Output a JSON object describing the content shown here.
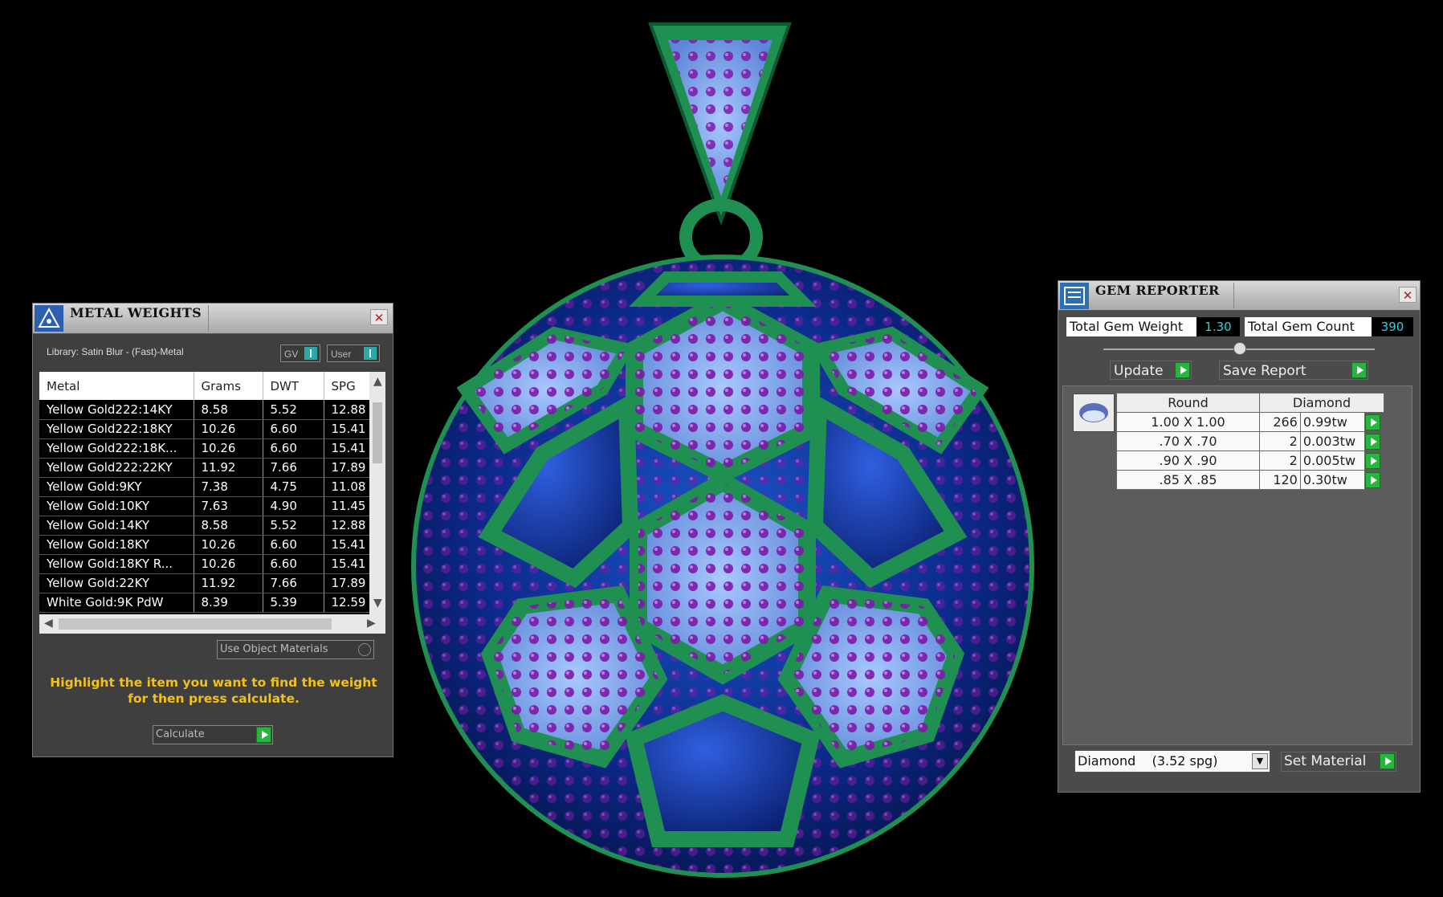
{
  "metal_panel": {
    "title": "METAL WEIGHTS",
    "library_label": "Library: Satin Blur - (Fast)-Metal",
    "toggle_gv": "GV",
    "toggle_user": "User",
    "columns": [
      "Metal",
      "Grams",
      "DWT",
      "SPG"
    ],
    "rows": [
      [
        "Yellow Gold222:14KY",
        "8.58",
        "5.52",
        "12.88"
      ],
      [
        "Yellow Gold222:18KY",
        "10.26",
        "6.60",
        "15.41"
      ],
      [
        "Yellow Gold222:18K...",
        "10.26",
        "6.60",
        "15.41"
      ],
      [
        "Yellow Gold222:22KY",
        "11.92",
        "7.66",
        "17.89"
      ],
      [
        "Yellow Gold:9KY",
        "7.38",
        "4.75",
        "11.08"
      ],
      [
        "Yellow Gold:10KY",
        "7.63",
        "4.90",
        "11.45"
      ],
      [
        "Yellow Gold:14KY",
        "8.58",
        "5.52",
        "12.88"
      ],
      [
        "Yellow Gold:18KY",
        "10.26",
        "6.60",
        "15.41"
      ],
      [
        "Yellow Gold:18KY R...",
        "10.26",
        "6.60",
        "15.41"
      ],
      [
        "Yellow Gold:22KY",
        "11.92",
        "7.66",
        "17.89"
      ],
      [
        "White Gold:9K PdW",
        "8.39",
        "5.39",
        "12.59"
      ]
    ],
    "use_object_materials": "Use Object Materials",
    "hint_line1": "Highlight the item you want to find the weight",
    "hint_line2": "for then press calculate.",
    "calculate_label": "Calculate"
  },
  "gem_panel": {
    "title": "GEM REPORTER",
    "total_weight_label": "Total Gem Weight",
    "total_weight_value": "1.30",
    "total_count_label": "Total Gem Count",
    "total_count_value": "390",
    "update_label": "Update",
    "save_report_label": "Save Report",
    "shape_header": "Round",
    "material_header": "Diamond",
    "gems": [
      {
        "size": "1.00 X 1.00",
        "count": "266",
        "weight": "0.99tw"
      },
      {
        "size": ".70 X .70",
        "count": "2",
        "weight": "0.003tw"
      },
      {
        "size": ".90 X .90",
        "count": "2",
        "weight": "0.005tw"
      },
      {
        "size": ".85 X .85",
        "count": "120",
        "weight": "0.30tw"
      }
    ],
    "material_select": "Diamond    (3.52 spg)",
    "set_material_label": "Set Material"
  },
  "colors": {
    "accent_green": "#27b53e",
    "hint_yellow": "#f4c01a",
    "value_cyan": "#2fd0e0",
    "pendant_metal": "#1f8f52",
    "pendant_blue": "#0c2a8c",
    "gem_purple": "#7a1aa8",
    "gem_light": "#8fb6f0"
  },
  "icons": [
    "metal-weights-icon",
    "gem-reporter-icon",
    "close-icon",
    "play-icon",
    "dropdown-arrow-icon"
  ]
}
